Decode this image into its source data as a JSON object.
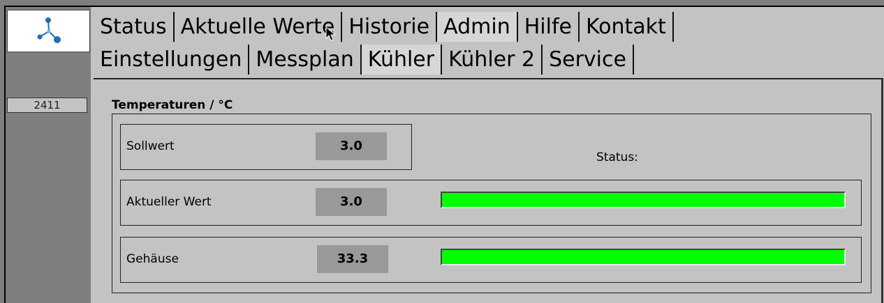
{
  "sidebar": {
    "device_id": "2411"
  },
  "tabs_primary": [
    "Status",
    "Aktuelle Werte",
    "Historie",
    "Admin",
    "Hilfe",
    "Kontakt"
  ],
  "tabs_primary_active": "Admin",
  "tabs_secondary": [
    "Einstellungen",
    "Messplan",
    "Kühler",
    "Kühler 2",
    "Service"
  ],
  "tabs_secondary_active": "Kühler",
  "panel": {
    "section_title": "Temperaturen / °C",
    "status_label": "Status:",
    "rows": [
      {
        "label": "Sollwert",
        "value": "3.0"
      },
      {
        "label": "Aktueller Wert",
        "value": "3.0",
        "bar_level": 1.0
      },
      {
        "label": "Gehäuse",
        "value": "33.3",
        "bar_level": 1.0
      }
    ]
  },
  "colors": {
    "status_ok": "#00ff00",
    "logo_blue": "#1e6fb8"
  }
}
